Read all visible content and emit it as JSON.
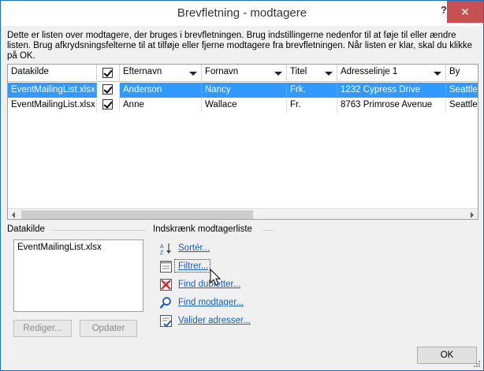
{
  "dialog": {
    "title": "Brevfletning - modtagere",
    "help_label": "?",
    "close_label": "✕",
    "intro": "Dette er listen over modtagere, der bruges i brevfletningen. Brug indstillingerne nedenfor til at føje til eller ændre listen. Brug afkrydsningsfelterne til at tilføje eller fjerne modtagere fra brevfletningen. Når listen er klar, skal du klikke på OK."
  },
  "grid": {
    "columns": [
      {
        "label": "Datakilde"
      },
      {
        "label": ""
      },
      {
        "label": "Efternavn"
      },
      {
        "label": "Fornavn"
      },
      {
        "label": "Titel"
      },
      {
        "label": "Adresselinje 1"
      },
      {
        "label": "By"
      }
    ],
    "rows": [
      {
        "datakilde": "EventMailingList.xlsx",
        "checked": true,
        "efternavn": "Anderson",
        "fornavn": "Nancy",
        "titel": "Frk.",
        "adresse": "1232 Cypress Drive",
        "by": "Seattle",
        "selected": true
      },
      {
        "datakilde": "EventMailingList.xlsx",
        "checked": true,
        "efternavn": "Anne",
        "fornavn": "Wallace",
        "titel": "Fr.",
        "adresse": "8763 Primrose Avenue",
        "by": "Seattle",
        "selected": false
      }
    ]
  },
  "datasource": {
    "label": "Datakilde",
    "items": [
      "EventMailingList.xlsx"
    ],
    "edit_button": "Rediger...",
    "refresh_button": "Opdater"
  },
  "refine": {
    "label": "Indskrænk modtagerliste",
    "links": [
      {
        "label": "Sortér...",
        "icon": "sort-az-icon"
      },
      {
        "label": "Filtrer...",
        "icon": "filter-icon"
      },
      {
        "label": "Find dubletter...",
        "icon": "find-duplicates-icon"
      },
      {
        "label": "Find modtager...",
        "icon": "find-recipient-icon"
      },
      {
        "label": "Valider adresser...",
        "icon": "validate-addresses-icon"
      }
    ]
  },
  "footer": {
    "ok_label": "OK"
  }
}
